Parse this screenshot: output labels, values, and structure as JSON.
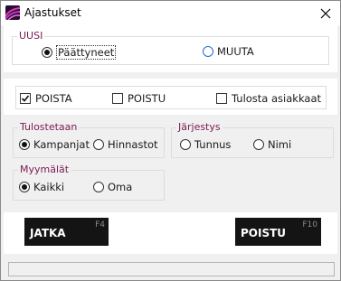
{
  "window": {
    "title": "Ajastukset"
  },
  "uusi": {
    "legend": "UUSI",
    "options": [
      {
        "label": "Päättyneet",
        "selected": true
      },
      {
        "label": "MUUTA",
        "selected": false
      }
    ]
  },
  "checks": [
    {
      "label": "POISTA",
      "checked": true
    },
    {
      "label": "POISTU",
      "checked": false
    },
    {
      "label": "Tulosta asiakkaat",
      "checked": false
    }
  ],
  "tulostetaan": {
    "legend": "Tulostetaan",
    "options": [
      {
        "label": "Kampanjat",
        "selected": true
      },
      {
        "label": "Hinnastot",
        "selected": false
      }
    ]
  },
  "jarjestys": {
    "legend": "Järjestys",
    "options": [
      {
        "label": "Tunnus",
        "selected": false
      },
      {
        "label": "Nimi",
        "selected": false
      }
    ]
  },
  "myymalat": {
    "legend": "Myymälät",
    "options": [
      {
        "label": "Kaikki",
        "selected": true
      },
      {
        "label": "Oma",
        "selected": false
      }
    ]
  },
  "buttons": {
    "jatka": {
      "label": "JATKA",
      "key": "F4"
    },
    "poistu": {
      "label": "POISTU",
      "key": "F10"
    }
  },
  "status": {
    "text": ""
  },
  "colors": {
    "legend": "#7b1a52",
    "button": "#141414",
    "radio_focus": "#1e73c8"
  }
}
